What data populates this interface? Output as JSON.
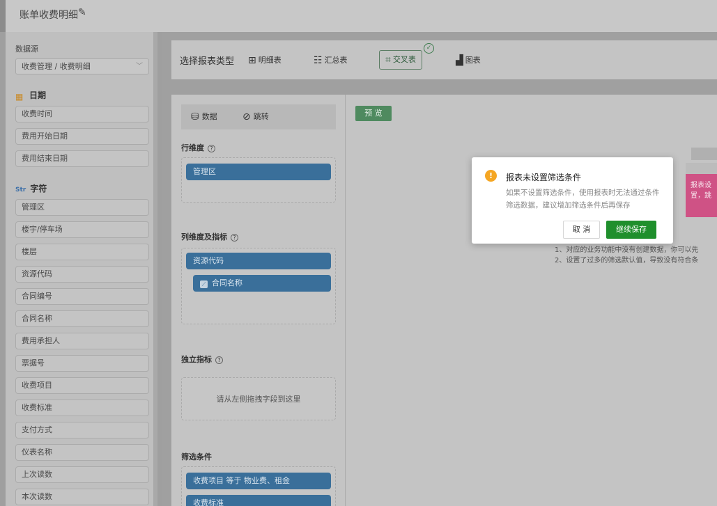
{
  "header": {
    "title": "账单收费明细",
    "edit_icon": "pencil-icon"
  },
  "sidebar": {
    "datasource_label": "数据源",
    "datasource_value": "收费管理 / 收费明细",
    "date_group": "日期",
    "date_fields": [
      "收费时间",
      "费用开始日期",
      "费用结束日期"
    ],
    "string_group_badge": "Str",
    "string_group": "字符",
    "string_fields": [
      "管理区",
      "楼宇/停车场",
      "楼层",
      "资源代码",
      "合同编号",
      "合同名称",
      "费用承担人",
      "票据号",
      "收费项目",
      "收费标准",
      "支付方式",
      "仪表名称",
      "上次读数",
      "本次读数"
    ]
  },
  "report_types": {
    "label": "选择报表类型",
    "types": [
      {
        "label": "明细表",
        "icon": "grid-table-icon"
      },
      {
        "label": "汇总表",
        "icon": "summary-table-icon"
      },
      {
        "label": "交叉表",
        "icon": "cross-table-icon",
        "active": true
      },
      {
        "label": "图表",
        "icon": "bar-chart-icon"
      }
    ]
  },
  "config": {
    "tab_data": "数据",
    "tab_jump": "跳转",
    "row_dim_label": "行维度",
    "row_dims": [
      "管理区"
    ],
    "col_dim_label": "列维度及指标",
    "col_dims": [
      "资源代码"
    ],
    "col_metrics": [
      "合同名称"
    ],
    "independent_label": "独立指标",
    "independent_placeholder": "请从左侧拖拽字段到这里",
    "filter_label": "筛选条件",
    "filters": [
      "收费项目 等于 物业费、租金",
      "收费标准"
    ]
  },
  "preview": {
    "button": "预 览",
    "pink_line1": "报表设",
    "pink_line2": "置，跳",
    "hint1": "1、对应的业务功能中没有创建数据，你可以先",
    "hint2": "2、设置了过多的筛选默认值，导致没有符合条"
  },
  "modal": {
    "title": "报表未设置筛选条件",
    "message": "如果不设置筛选条件，使用报表时无法通过条件筛选数据，建议增加筛选条件后再保存",
    "cancel": "取 消",
    "confirm": "继续保存",
    "warn_color": "#f5a623",
    "confirm_color": "#1f8f2c"
  }
}
